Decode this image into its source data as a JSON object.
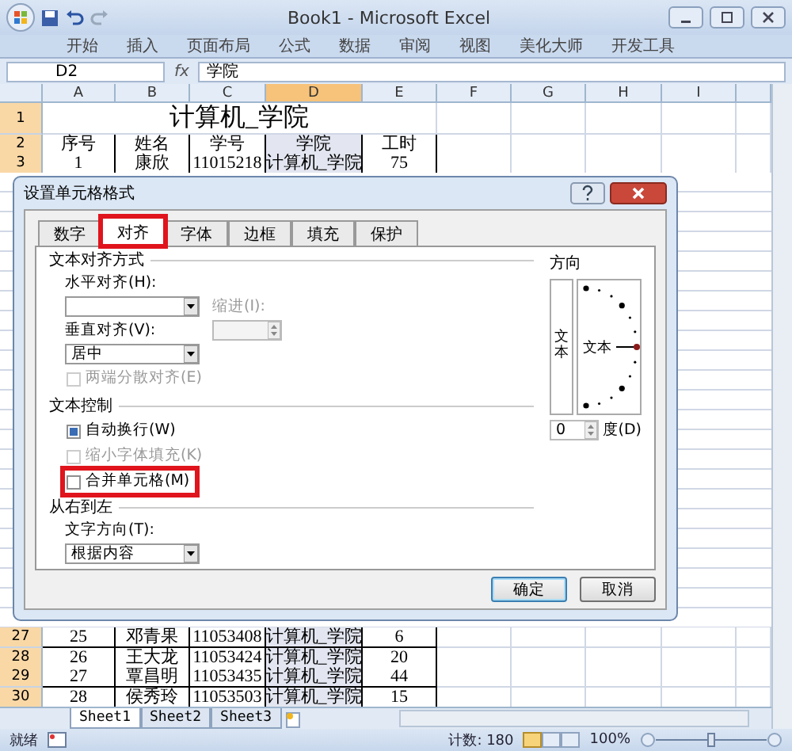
{
  "window": {
    "title": "Book1 - Microsoft Excel"
  },
  "ribbon_tabs": [
    "开始",
    "插入",
    "页面布局",
    "公式",
    "数据",
    "审阅",
    "视图",
    "美化大师",
    "开发工具"
  ],
  "formula_bar": {
    "name_box": "D2",
    "function_label": "fx",
    "value": "学院"
  },
  "sheet": {
    "columns": [
      {
        "label": "A",
        "selected": false
      },
      {
        "label": "B",
        "selected": false
      },
      {
        "label": "C",
        "selected": false
      },
      {
        "label": "D",
        "selected": true
      },
      {
        "label": "E",
        "selected": false
      },
      {
        "label": "F",
        "selected": false
      },
      {
        "label": "G",
        "selected": false
      },
      {
        "label": "H",
        "selected": false
      },
      {
        "label": "I",
        "selected": false
      }
    ],
    "title_row": {
      "row": "1",
      "text": "计算机_学院"
    },
    "rows": [
      {
        "row": "2",
        "cells": [
          "序号",
          "姓名",
          "学号",
          "学院",
          "工时"
        ]
      },
      {
        "row": "3",
        "cells": [
          "1",
          "康欣",
          "11015218",
          "计算机_学院",
          "75"
        ]
      }
    ],
    "bottom_rows": [
      {
        "row": "27",
        "cells": [
          "25",
          "邓青果",
          "11053408",
          "计算机_学院",
          "6"
        ]
      },
      {
        "row": "28",
        "cells": [
          "26",
          "王大龙",
          "11053424",
          "计算机_学院",
          "20"
        ]
      },
      {
        "row": "29",
        "cells": [
          "27",
          "覃昌明",
          "11053435",
          "计算机_学院",
          "44"
        ]
      },
      {
        "row": "30",
        "cells": [
          "28",
          "侯秀玲",
          "11053503",
          "计算机_学院",
          "15"
        ]
      }
    ]
  },
  "sheet_tabs": [
    {
      "label": "Sheet1",
      "selected": true
    },
    {
      "label": "Sheet2",
      "selected": false
    },
    {
      "label": "Sheet3",
      "selected": false
    }
  ],
  "status_bar": {
    "ready": "就绪",
    "count": "计数: 180",
    "zoom": "100%"
  },
  "dialog": {
    "title": "设置单元格格式",
    "tabs": [
      {
        "label": "数字",
        "selected": false,
        "highlighted": false
      },
      {
        "label": "对齐",
        "selected": true,
        "highlighted": true
      },
      {
        "label": "字体",
        "selected": false,
        "highlighted": false
      },
      {
        "label": "边框",
        "selected": false,
        "highlighted": false
      },
      {
        "label": "填充",
        "selected": false,
        "highlighted": false
      },
      {
        "label": "保护",
        "selected": false,
        "highlighted": false
      }
    ],
    "alignment": {
      "heading": "文本对齐方式",
      "horizontal_label": "水平对齐(H):",
      "indent_label": "缩进(I):",
      "vertical_label": "垂直对齐(V):",
      "vertical_value": "居中",
      "distributed": {
        "label": "两端分散对齐(E)",
        "checked": false,
        "disabled": true
      }
    },
    "text_control": {
      "heading": "文本控制",
      "options": [
        {
          "label": "自动换行(W)",
          "checked": true,
          "disabled": false,
          "highlighted": false
        },
        {
          "label": "缩小字体填充(K)",
          "checked": false,
          "disabled": true,
          "highlighted": false
        },
        {
          "label": "合并单元格(M)",
          "checked": false,
          "disabled": false,
          "highlighted": true
        }
      ]
    },
    "right_to_left": {
      "heading": "从右到左",
      "direction_label": "文字方向(T):",
      "direction_value": "根据内容"
    },
    "orientation": {
      "heading": "方向",
      "vertical_text": "文本",
      "dial_text": "文本",
      "degrees": "0",
      "degrees_label": "度(D)"
    },
    "buttons": [
      {
        "label": "确定",
        "default": true
      },
      {
        "label": "取消",
        "default": false
      }
    ]
  }
}
